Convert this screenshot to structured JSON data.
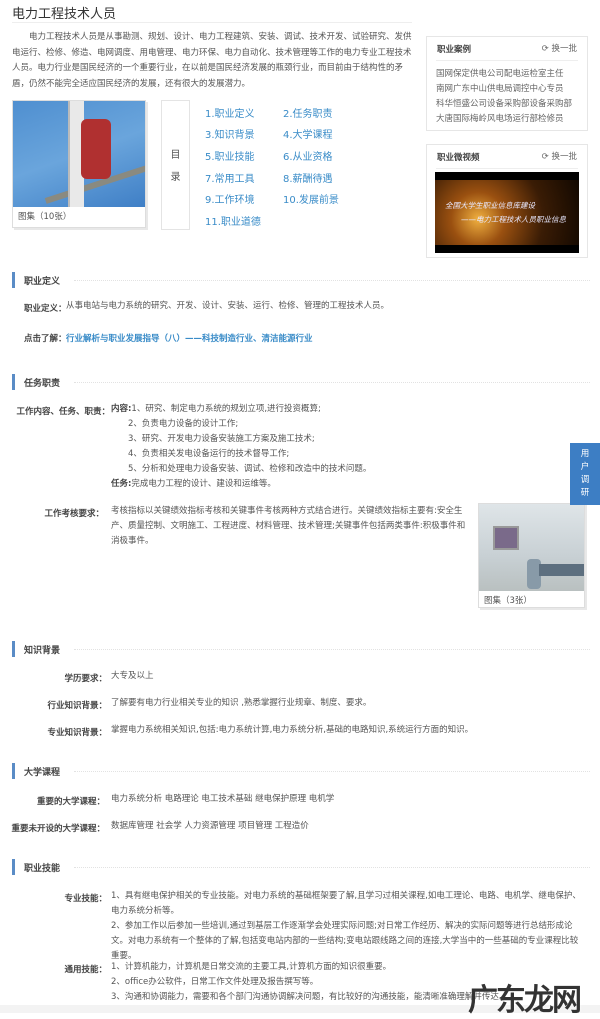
{
  "page_title": "电力工程技术人员",
  "intro": "电力工程技术人员是从事勘测、规划、设计、电力工程建筑、安装、调试、技术开发、试验研究、发供电运行、检修、修造、电网调度、用电管理、电力环保、电力自动化、技术管理等工作的电力专业工程技术人员。电力行业是国民经济的一个重要行业，在以前是国民经济发展的瓶颈行业，而目前由于结构性的矛盾，仍然不能完全适应国民经济的发展，还有很大的发展潜力。",
  "gallery1_caption": "图集（10张）",
  "toc": {
    "label": [
      "目",
      "录"
    ],
    "items": [
      "1.职业定义",
      "2.任务职责",
      "3.知识背景",
      "4.大学课程",
      "5.职业技能",
      "6.从业资格",
      "7.常用工具",
      "8.薪酬待遇",
      "9.工作环境",
      "10.发展前景",
      "11.职业道德"
    ]
  },
  "sidebar": {
    "cases": {
      "title": "职业案例",
      "refresh": "换一批",
      "items": [
        "国网保定供电公司配电运检室主任",
        "南网广东中山供电局调控中心专员",
        "科华恒盛公司设备采购部设备采购部",
        "大唐国际梅岭风电场运行部检修员"
      ]
    },
    "videos": {
      "title": "职业微视频",
      "refresh": "换一批",
      "video_text": [
        "全国大学生职业信息库建设",
        "——电力工程技术人员职业信息"
      ]
    }
  },
  "sections": {
    "definition": {
      "title": "职业定义",
      "label": "职业定义：",
      "text": "从事电站与电力系统的研究、开发、设计、安装、运行、检修、管理的工程技术人员。",
      "more_label": "点击了解：",
      "more_link": "行业解析与职业发展指导（八）——科技制造行业、清洁能源行业"
    },
    "duties": {
      "title": "任务职责",
      "content_label": "工作内容、任务、职责：",
      "content_head": "内容:",
      "content_items": [
        "1、研究、制定电力系统的规划立项,进行投资概算;",
        "2、负责电力设备的设计工作;",
        "3、研究、开发电力设备安装施工方案及施工技术;",
        "4、负责相关发电设备运行的技术督导工作;",
        "5、分析和处理电力设备安装、调试、检修和改造中的技术问题。"
      ],
      "task_head": "任务:",
      "task_text": "完成电力工程的设计、建设和运维等。",
      "assess_label": "工作考核要求：",
      "assess_text": "考核指标以关键绩效指标考核和关键事件考核两种方式结合进行。关键绩效指标主要有:安全生产、质量控制、文明施工、工程进度、材料管理、技术管理;关键事件包括两类事件:积极事件和消极事件。",
      "gallery_caption": "图集（3张）"
    },
    "knowledge": {
      "title": "知识背景",
      "rows": [
        {
          "label": "学历要求：",
          "text": "大专及以上"
        },
        {
          "label": "行业知识背景：",
          "text": "了解要有电力行业相关专业的知识 ,熟悉掌握行业规章、制度、要求。"
        },
        {
          "label": "专业知识背景：",
          "text": "掌握电力系统相关知识,包括:电力系统计算,电力系统分析,基础的电路知识,系统运行方面的知识。"
        }
      ]
    },
    "courses": {
      "title": "大学课程",
      "rows": [
        {
          "label": "重要的大学课程：",
          "text": "电力系统分析 电路理论 电工技术基础 继电保护原理 电机学"
        },
        {
          "label": "重要未开设的大学课程：",
          "text": "数据库管理 社会学 人力资源管理 项目管理 工程造价"
        }
      ]
    },
    "skills": {
      "title": "职业技能",
      "pro_label": "专业技能：",
      "pro_items": [
        "1、具有继电保护相关的专业技能。对电力系统的基础框架要了解,且学习过相关课程,如电工理论、电路、电机学、继电保护、电力系统分析等。",
        "2、参加工作以后参加一些培训,通过到基层工作逐渐学会处理实际问题;对日常工作经历、解决的实际问题等进行总结形成论文。对电力系统有一个整体的了解,包括变电站内部的一些结构;变电站跟线路之间的连接,大学当中的一些基础的专业课程比较重要。"
      ],
      "gen_label": "通用技能：",
      "gen_items": [
        "1、计算机能力，计算机是日常交流的主要工具,计算机方面的知识很重要。",
        "2、office办公软件，日常工作文件处理及报告撰写等。",
        "3、沟通和协调能力，需要和各个部门沟通协调解决问题，有比较好的沟通技能，能清晰准确理解并传达。"
      ]
    }
  },
  "side_tab": [
    "用",
    "户",
    "调",
    "研"
  ],
  "watermark": "广东龙网",
  "colors": {
    "accent": "#3a8cc8",
    "section_bar": "#5a8cc6",
    "side_tab": "#3d7ec4"
  }
}
